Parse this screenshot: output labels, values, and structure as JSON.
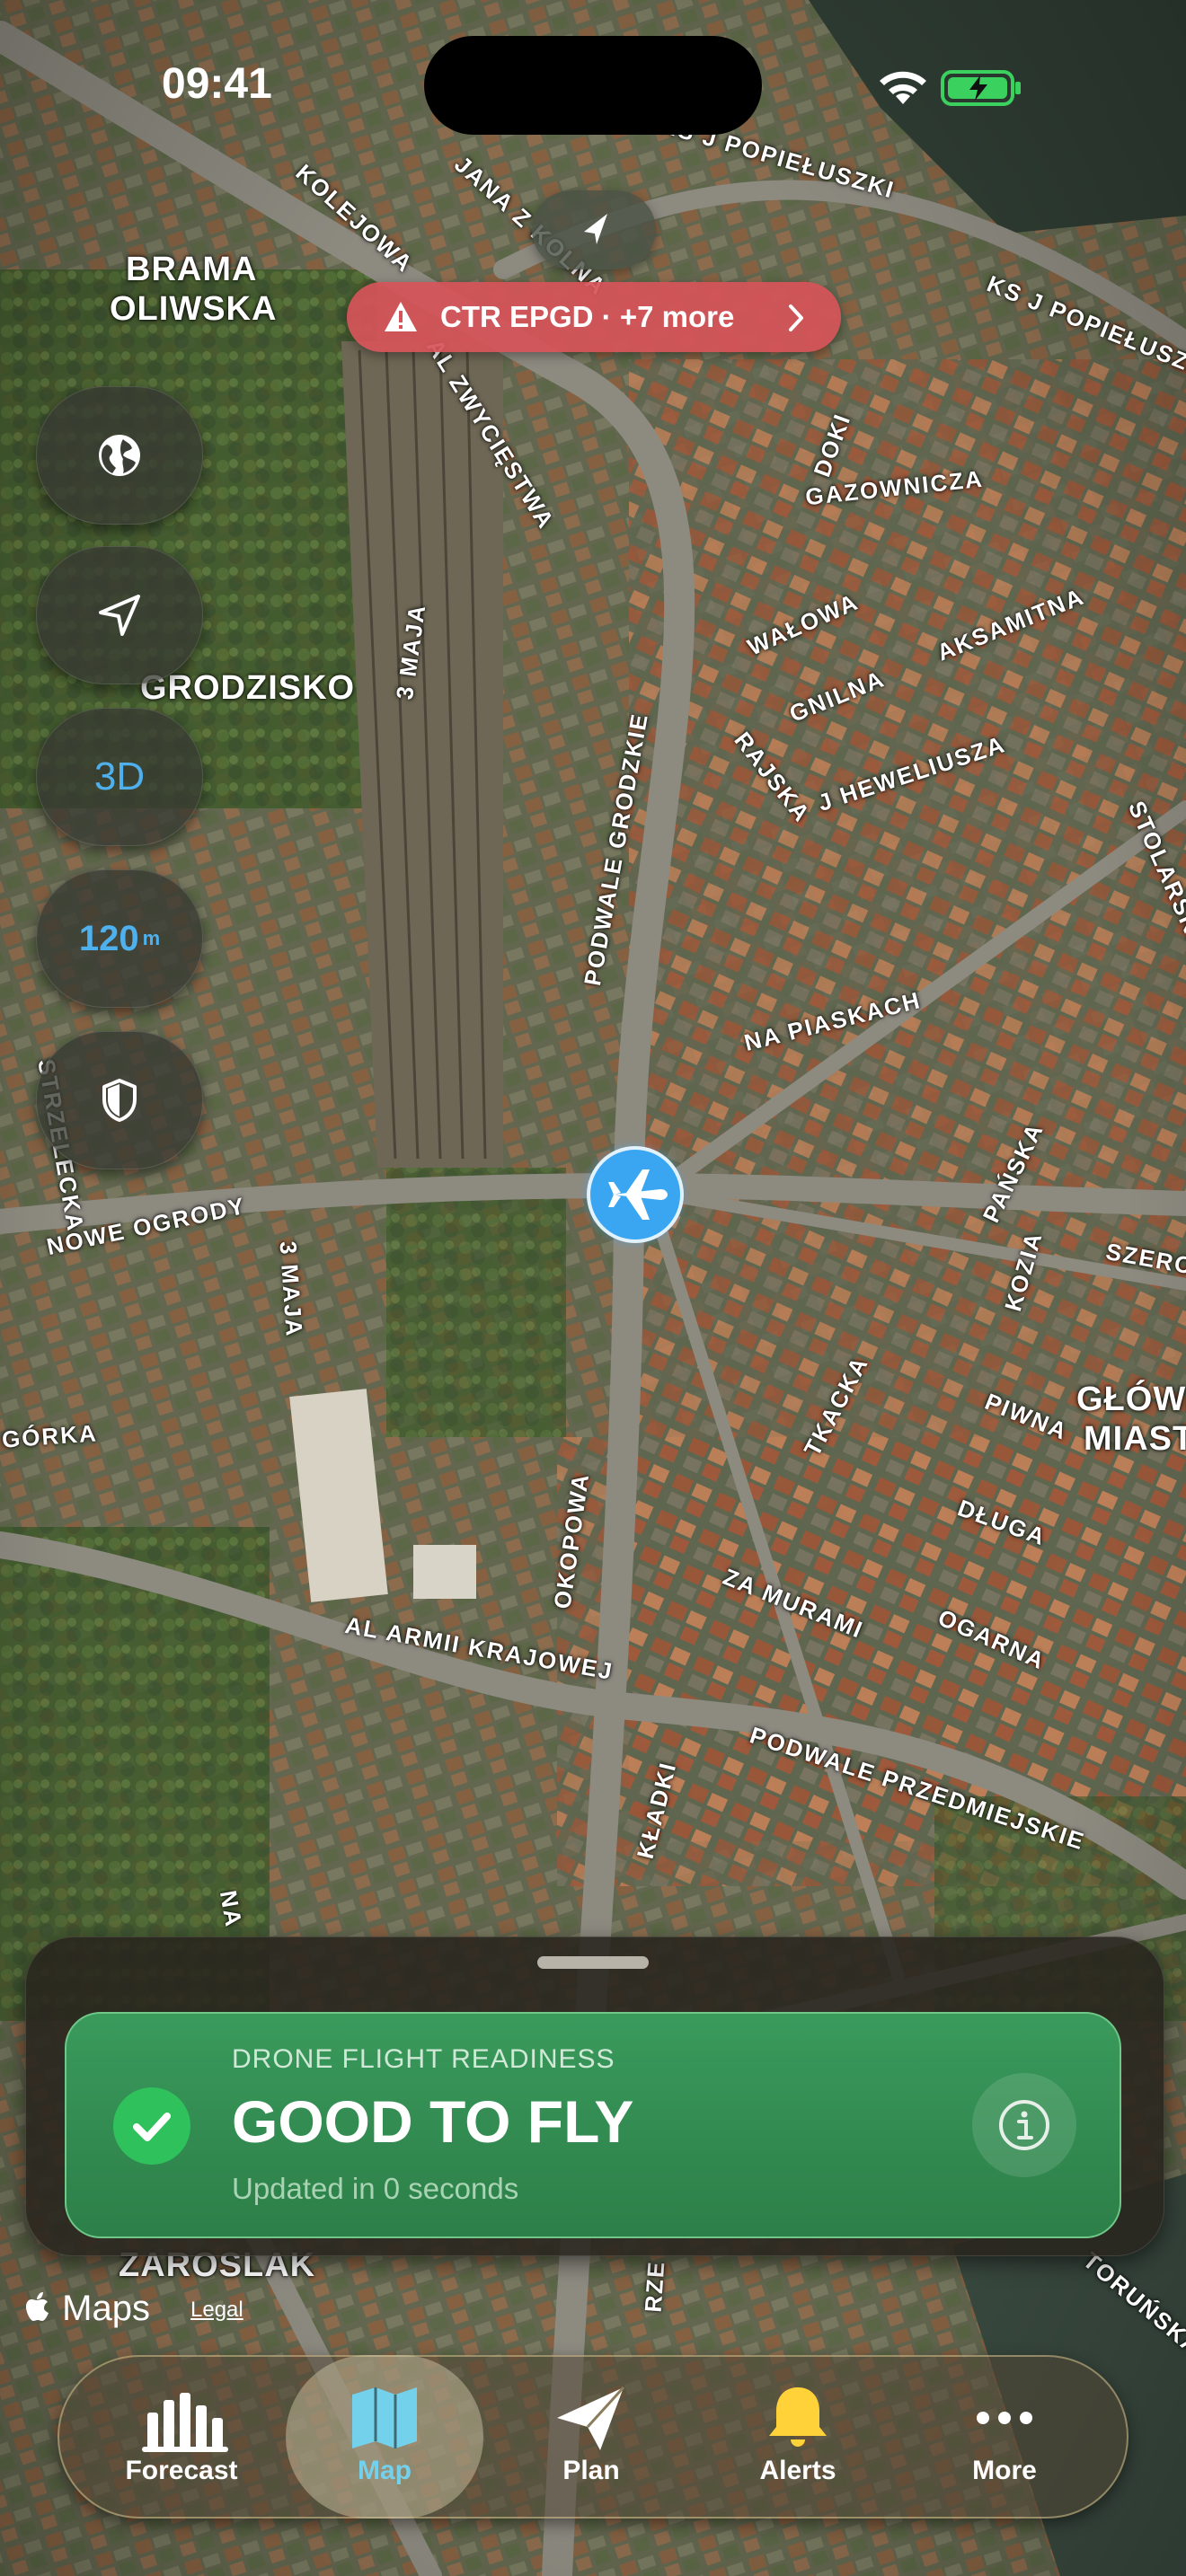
{
  "status_bar": {
    "time": "09:41"
  },
  "map_labels": [
    "KS J POPIEŁUSZKI",
    "KOLEJOWA",
    "JANA Z KOLNA",
    "BRAMA",
    "OLIWSKA",
    "AL ZWYCIĘSTWA",
    "KS J POPIEŁUSZKI",
    "DOKI",
    "GAZOWNICZA",
    "WAŁOWA",
    "AKSAMITNA",
    "GNILNA",
    "RAJSKA",
    "J HEWELIUSZA",
    "STOLARSKA",
    "3 MAJA",
    "GRODZISKO",
    "PODWALE GRODZKIE",
    "NA PIASKACH",
    "STRZELECKA",
    "NOWE OGRODY",
    "3 MAJA",
    "PAŃSKA",
    "SZEROKA",
    "KOZIA",
    "GÓRKA",
    "TKACKA",
    "PIWNA",
    "GŁÓWNE",
    "MIASTO",
    "DŁUGA",
    "OKOPOWA",
    "ZA MURAMI",
    "OGARNA",
    "AL ARMII KRAJOWEJ",
    "KŁADKI",
    "PODWALE PRZEDMIEJSKIE",
    "NA",
    "ZAROSLAK",
    "RZE",
    "TORUŃSKA"
  ],
  "top": {
    "alert_text": "CTR EPGD · +7 more",
    "alert_color": "#d65459"
  },
  "controls": {
    "mode_3d": "3D",
    "altitude_value": "120",
    "altitude_unit": "m",
    "accent_color": "#4fb0ee"
  },
  "readiness": {
    "label": "DRONE FLIGHT READINESS",
    "status": "GOOD TO FLY",
    "updated": "Updated in 0 seconds",
    "status_color": "#2fc25c"
  },
  "attribution": {
    "maps": "Maps",
    "legal": "Legal"
  },
  "tabs": [
    {
      "label": "Forecast",
      "icon": "chart-bars-icon"
    },
    {
      "label": "Map",
      "icon": "map-icon"
    },
    {
      "label": "Plan",
      "icon": "paper-plane-icon"
    },
    {
      "label": "Alerts",
      "icon": "bell-icon"
    },
    {
      "label": "More",
      "icon": "ellipsis-icon"
    }
  ]
}
